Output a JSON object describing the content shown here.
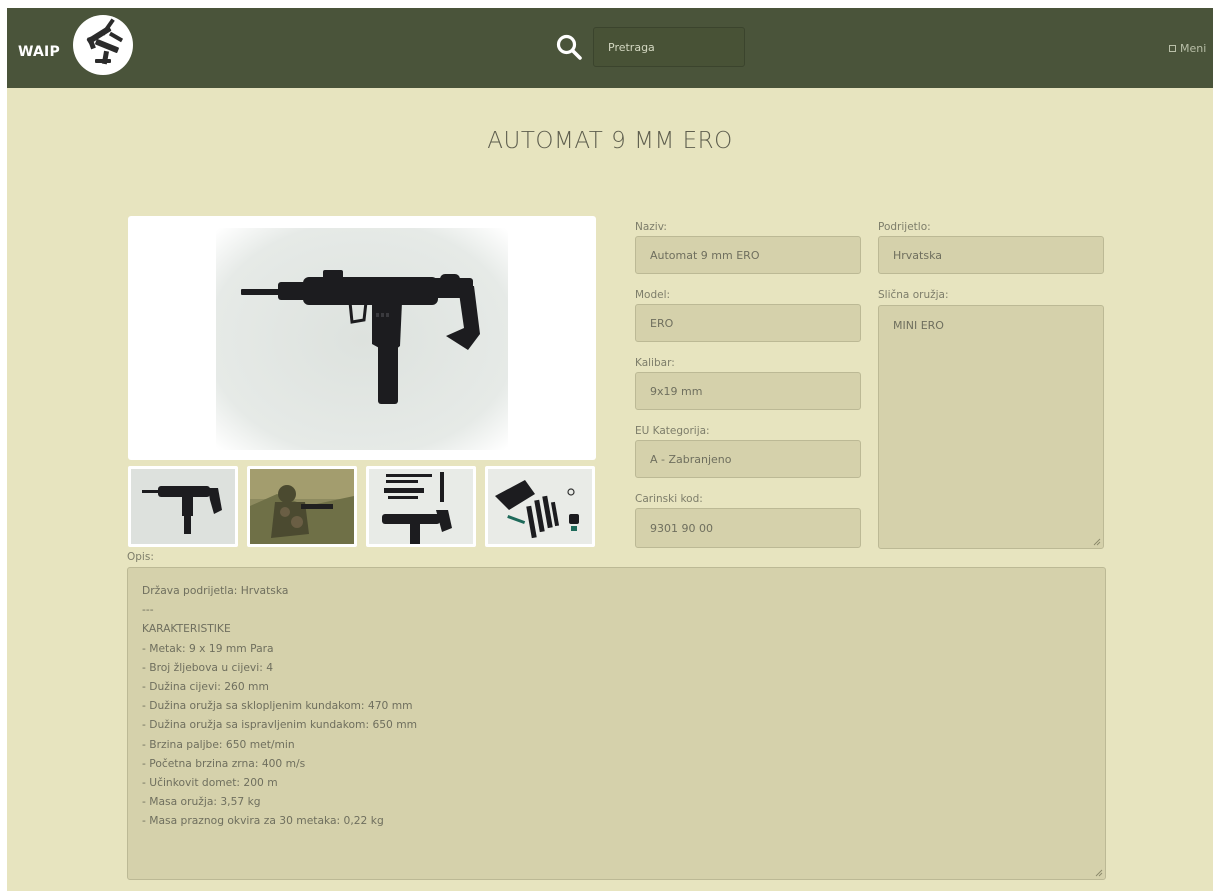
{
  "header": {
    "brand": "WAIP",
    "search_placeholder": "Pretraga",
    "menu_label": "Meni"
  },
  "page": {
    "title": "AUTOMAT 9 MM ERO"
  },
  "fields": {
    "naziv": {
      "label": "Naziv:",
      "value": "Automat 9 mm ERO"
    },
    "model": {
      "label": "Model:",
      "value": "ERO"
    },
    "kalibar": {
      "label": "Kalibar:",
      "value": "9x19 mm"
    },
    "eu_kategorija": {
      "label": "EU Kategorija:",
      "value": "A - Zabranjeno"
    },
    "carinski_kod": {
      "label": "Carinski kod:",
      "value": "9301 90 00"
    },
    "podrijetlo": {
      "label": "Podrijetlo:",
      "value": "Hrvatska"
    },
    "slicna_oruzja": {
      "label": "Slična oružja:",
      "value": "MINI ERO"
    }
  },
  "description": {
    "label": "Opis:",
    "lines": [
      "Država podrijetla: Hrvatska",
      "---",
      "KARAKTERISTIKE",
      "- Metak:  9 x 19 mm Para",
      "- Broj žljebova u cijevi: 4",
      "- Dužina cijevi:  260 mm",
      "- Dužina oružja sa sklopljenim kundakom:  470 mm",
      "- Dužina oružja sa ispravljenim kundakom: 650 mm",
      "- Brzina paljbe: 650 met/min",
      "- Početna brzina zrna: 400 m/s",
      "- Učinkovit domet: 200 m",
      "- Masa oružja: 3,57 kg",
      "- Masa praznog okvira za 30 metaka:  0,22 kg"
    ]
  },
  "colors": {
    "navbar": "#4a543a",
    "background": "#e7e4bf",
    "field_bg": "#d5d1ab",
    "text": "#6f6f5e"
  },
  "icons": [
    "search-icon",
    "menu-icon",
    "logo-icon",
    "resize-grip-icon"
  ]
}
